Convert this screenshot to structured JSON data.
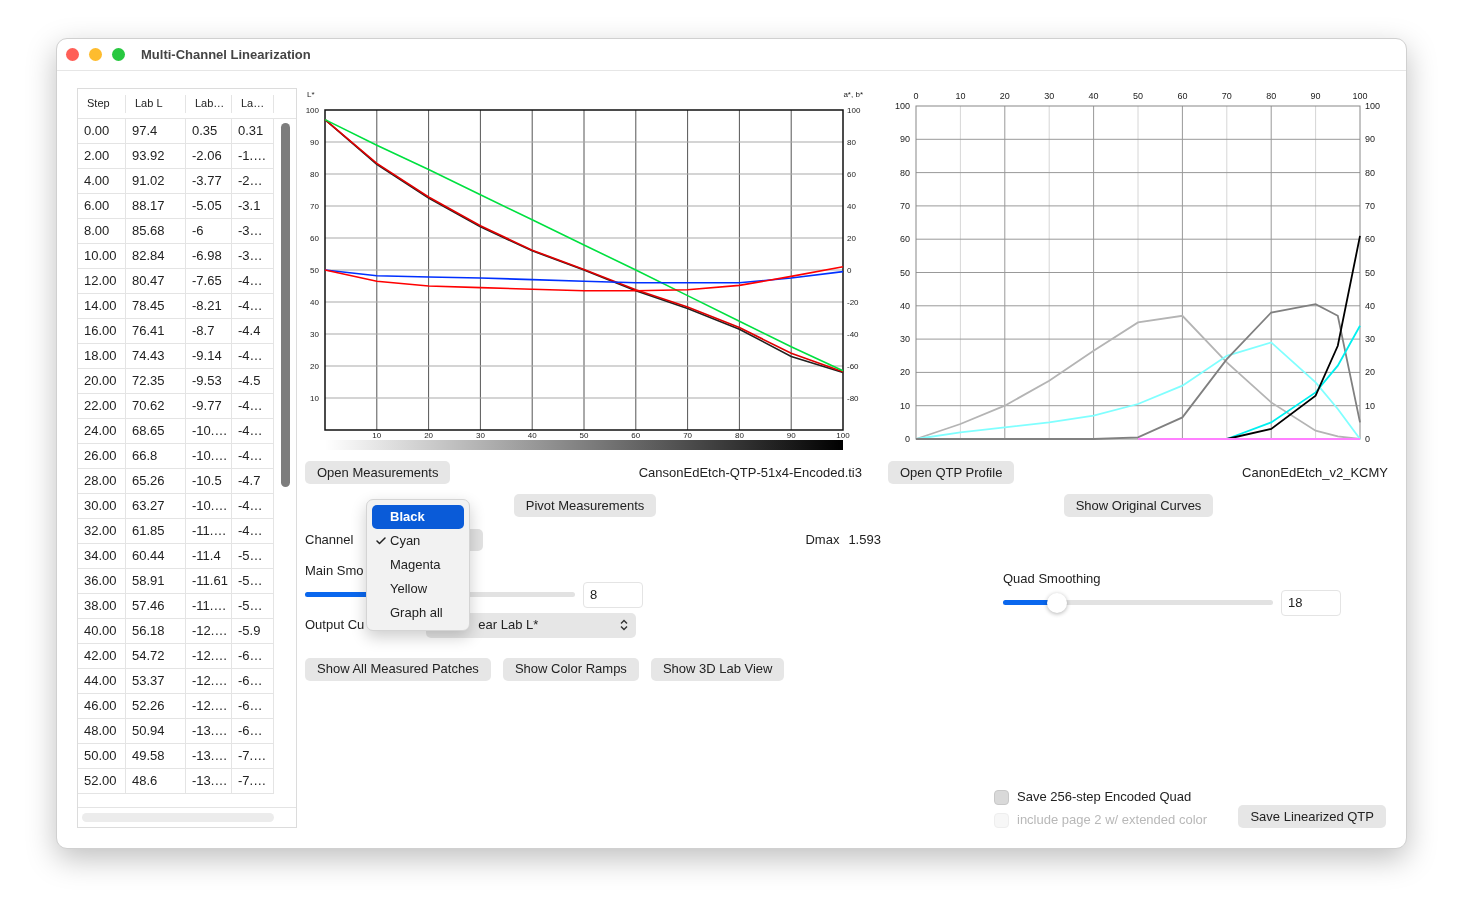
{
  "window": {
    "title": "Multi-Channel Linearization"
  },
  "table": {
    "columns": [
      "Step",
      "Lab L",
      "Lab…",
      "La…"
    ],
    "rows": [
      [
        "0.00",
        "97.4",
        "0.35",
        "0.31"
      ],
      [
        "2.00",
        "93.92",
        "-2.06",
        "-1.…"
      ],
      [
        "4.00",
        "91.02",
        "-3.77",
        "-2…"
      ],
      [
        "6.00",
        "88.17",
        "-5.05",
        "-3.1"
      ],
      [
        "8.00",
        "85.68",
        "-6",
        "-3…"
      ],
      [
        "10.00",
        "82.84",
        "-6.98",
        "-3…"
      ],
      [
        "12.00",
        "80.47",
        "-7.65",
        "-4…"
      ],
      [
        "14.00",
        "78.45",
        "-8.21",
        "-4…"
      ],
      [
        "16.00",
        "76.41",
        "-8.7",
        "-4.4"
      ],
      [
        "18.00",
        "74.43",
        "-9.14",
        "-4…"
      ],
      [
        "20.00",
        "72.35",
        "-9.53",
        "-4.5"
      ],
      [
        "22.00",
        "70.62",
        "-9.77",
        "-4…"
      ],
      [
        "24.00",
        "68.65",
        "-10.…",
        "-4…"
      ],
      [
        "26.00",
        "66.8",
        "-10.…",
        "-4…"
      ],
      [
        "28.00",
        "65.26",
        "-10.5",
        "-4.7"
      ],
      [
        "30.00",
        "63.27",
        "-10.…",
        "-4…"
      ],
      [
        "32.00",
        "61.85",
        "-11.…",
        "-4…"
      ],
      [
        "34.00",
        "60.44",
        "-11.4",
        "-5…"
      ],
      [
        "36.00",
        "58.91",
        "-11.61",
        "-5…"
      ],
      [
        "38.00",
        "57.46",
        "-11.…",
        "-5…"
      ],
      [
        "40.00",
        "56.18",
        "-12.…",
        "-5.9"
      ],
      [
        "42.00",
        "54.72",
        "-12.…",
        "-6…"
      ],
      [
        "44.00",
        "53.37",
        "-12.…",
        "-6…"
      ],
      [
        "46.00",
        "52.26",
        "-12.…",
        "-6…"
      ],
      [
        "48.00",
        "50.94",
        "-13.…",
        "-6…"
      ],
      [
        "50.00",
        "49.58",
        "-13.…",
        "-7.…"
      ],
      [
        "52.00",
        "48.6",
        "-13.…",
        "-7.…"
      ]
    ]
  },
  "measurement_chart": {
    "left_axis_label": "L*",
    "right_axis_label": "a*, b*",
    "right_ticks": [
      "100",
      "80",
      "60",
      "40",
      "20",
      "0",
      "-20",
      "-40",
      "-60",
      "-80"
    ],
    "chart_data": {
      "type": "line",
      "grid": true,
      "x": [
        0,
        10,
        20,
        30,
        40,
        50,
        60,
        70,
        80,
        90,
        100
      ],
      "xlim": [
        0,
        100
      ],
      "ylim": [
        0,
        100
      ],
      "xticks": [
        10,
        20,
        30,
        40,
        50,
        60,
        70,
        80,
        90,
        100
      ],
      "yticks": [
        10,
        20,
        30,
        40,
        50,
        60,
        70,
        80,
        90,
        100
      ],
      "series": [
        {
          "color": "#222222",
          "values": [
            97,
            83,
            72.5,
            63.5,
            56,
            50,
            43.5,
            38,
            31.5,
            23,
            18
          ]
        },
        {
          "color": "#e00000",
          "values": [
            97,
            83.3,
            72.8,
            63.8,
            56.2,
            50.2,
            43.8,
            38.4,
            32,
            24,
            18.2
          ]
        },
        {
          "color": "#00e040",
          "values": [
            97,
            89,
            81.4,
            73.5,
            65.7,
            57.8,
            50,
            42,
            34,
            26,
            18.5
          ]
        },
        {
          "color": "#0030ff",
          "values": [
            50,
            48.2,
            47.8,
            47.5,
            47,
            46.5,
            46,
            46,
            46,
            47.5,
            49.5
          ]
        },
        {
          "color": "#ff0000",
          "values": [
            50,
            46.5,
            45,
            44.5,
            44,
            43.5,
            43.5,
            43.8,
            45.2,
            48,
            51
          ]
        }
      ]
    }
  },
  "measurements": {
    "open_button": "Open Measurements",
    "file_name": "CansonEdEtch-QTP-51x4-Encoded.ti3",
    "pivot_button": "Pivot Measurements"
  },
  "channel": {
    "label": "Channel",
    "menu": [
      {
        "label": "Black",
        "selected": false,
        "highlighted": true
      },
      {
        "label": "Cyan",
        "selected": true,
        "highlighted": false
      },
      {
        "label": "Magenta",
        "selected": false,
        "highlighted": false
      },
      {
        "label": "Yellow",
        "selected": false,
        "highlighted": false
      },
      {
        "label": "Graph all",
        "selected": false,
        "highlighted": false
      }
    ]
  },
  "dmax": {
    "label": "Dmax",
    "value": "1.593"
  },
  "main_smoothing": {
    "label": "Main Smo",
    "level": 0.3,
    "value": "8"
  },
  "output_curve": {
    "label": "Output Cu",
    "value": "ear Lab L*"
  },
  "buttons": [
    "Show All Measured Patches",
    "Show Color Ramps",
    "Show 3D Lab View"
  ],
  "qtp_chart": {
    "left_ticks": [
      "100",
      "90",
      "80",
      "70",
      "60",
      "50",
      "40",
      "30",
      "20",
      "10",
      "0"
    ],
    "right_ticks": [
      "100",
      "90",
      "80",
      "70",
      "60",
      "50",
      "40",
      "30",
      "20",
      "10",
      "0"
    ],
    "chart_data": {
      "type": "line",
      "grid": true,
      "x": [
        0,
        10,
        20,
        30,
        40,
        50,
        60,
        70,
        80,
        90,
        95,
        100
      ],
      "xlim": [
        0,
        100
      ],
      "ylim": [
        0,
        100
      ],
      "xticks": [
        0,
        10,
        20,
        30,
        40,
        50,
        60,
        70,
        80,
        90,
        100
      ],
      "yticks": [
        0,
        10,
        20,
        30,
        40,
        50,
        60,
        70,
        80,
        90,
        100
      ],
      "series": [
        {
          "color": "#b4b4b4",
          "values": [
            0,
            4.5,
            10,
            17.5,
            26.5,
            35,
            37,
            23,
            11,
            2.5,
            0.8,
            0
          ]
        },
        {
          "color": "#80ffff",
          "values": [
            0,
            2,
            3.5,
            5,
            7,
            10.5,
            16,
            25,
            29,
            17,
            9,
            0
          ]
        },
        {
          "color": "#808080",
          "values": [
            0,
            0,
            0,
            0,
            0,
            0.5,
            6.5,
            24,
            38,
            40.5,
            37,
            5
          ]
        },
        {
          "color": "#00f0f0",
          "values": [
            null,
            null,
            null,
            null,
            null,
            null,
            null,
            0,
            5,
            14,
            22,
            34
          ]
        },
        {
          "color": "#000000",
          "values": [
            null,
            null,
            null,
            null,
            null,
            null,
            null,
            0,
            3,
            13,
            28,
            61
          ]
        },
        {
          "color": "#ff80ff",
          "values": [
            null,
            null,
            null,
            null,
            null,
            0,
            0,
            0,
            0,
            0,
            0,
            0
          ]
        }
      ]
    }
  },
  "qtp": {
    "open_button": "Open QTP Profile",
    "file_name": "CanonEdEtch_v2_KCMY",
    "original_curves_button": "Show Original Curves"
  },
  "quad_smoothing": {
    "label": "Quad Smoothing",
    "level": 0.2,
    "value": "18"
  },
  "options": [
    {
      "label": "Save 256-step Encoded Quad",
      "checked": false,
      "disabled": false
    },
    {
      "label": "include page 2 w/ extended color",
      "checked": false,
      "disabled": true
    }
  ],
  "save_button": "Save Linearized QTP"
}
